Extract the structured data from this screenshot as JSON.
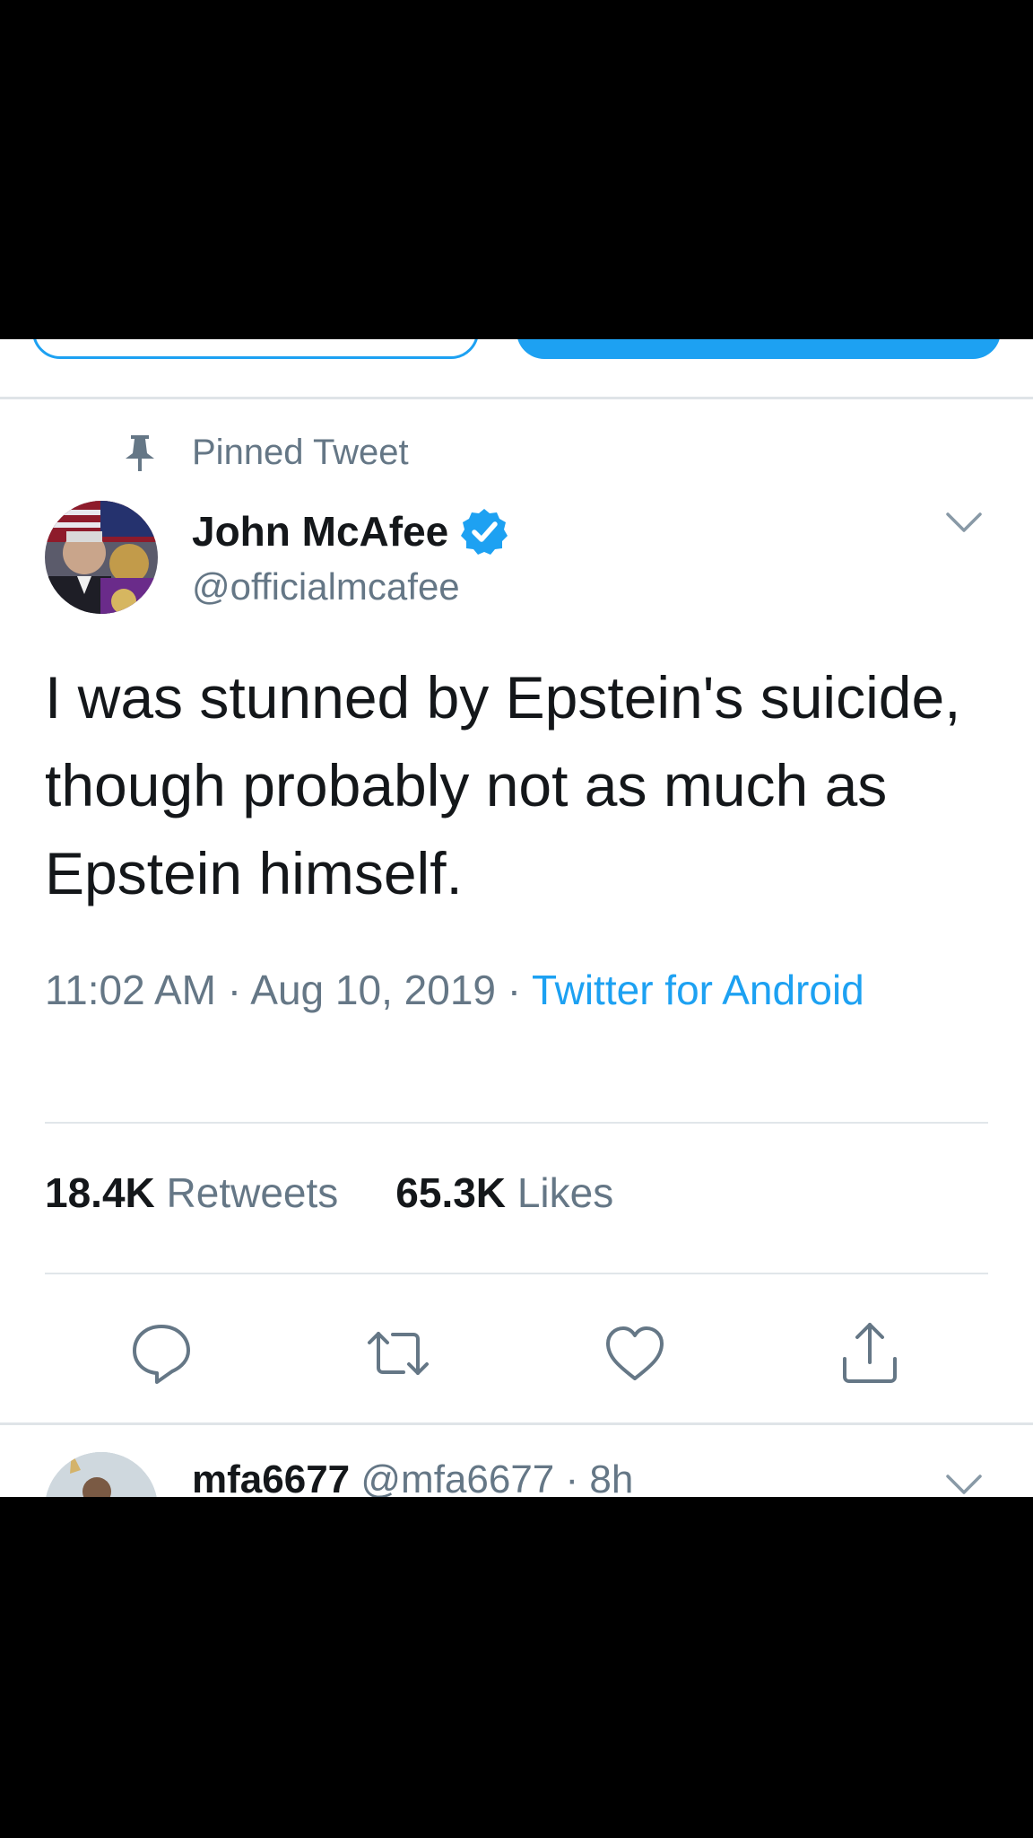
{
  "pinned": {
    "label": "Pinned Tweet"
  },
  "tweet": {
    "display_name": "John McAfee",
    "handle": "@officialmcafee",
    "text": "I was stunned by Epstein's suicide, though probably not as much as Epstein himself.",
    "time": "11:02 AM",
    "date": "Aug 10, 2019",
    "source": "Twitter for Android",
    "separator": " · ",
    "retweets_count": "18.4K",
    "retweets_label": "Retweets",
    "likes_count": "65.3K",
    "likes_label": "Likes"
  },
  "reply": {
    "display_name": "mfa6677",
    "handle": "@mfa6677",
    "time": "8h"
  },
  "icons": {
    "pin": "pin-icon",
    "verified": "verified-badge-icon",
    "more": "chevron-down-icon",
    "reply": "reply-icon",
    "retweet": "retweet-icon",
    "like": "heart-icon",
    "share": "share-icon"
  },
  "colors": {
    "accent": "#1da1f2",
    "secondary_text": "#657786",
    "primary_text": "#14171a",
    "divider": "#e1e6ea"
  }
}
